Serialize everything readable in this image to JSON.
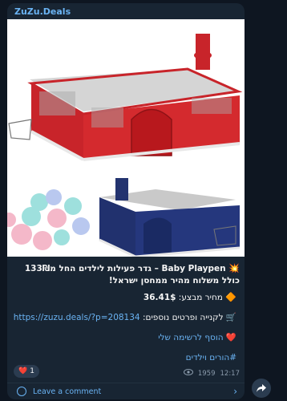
{
  "channel": {
    "name": "ZuZu.Deals"
  },
  "message": {
    "title_emoji": "💥",
    "title": "Baby Playpen – גדר פעילות לילדים החל מ133₪ כולל משלוח מהיר ממחסן ישראל!",
    "price_emoji": "🔶",
    "price_label": "מחיר מבצע:",
    "price_value": "36.41$",
    "buy_emoji": "🛒",
    "buy_label": "לקנייה ופרטים נוספים:",
    "buy_link": "https://zuzu.deals/?p=208134",
    "wishlist_emoji": "❤️",
    "wishlist_text": "הוסף לרשימה שלי",
    "hashtag": "#הורים וילדים"
  },
  "reactions": {
    "emoji": "❤️",
    "count": "1"
  },
  "meta": {
    "views": "1959",
    "time": "12:17"
  },
  "comment": {
    "label": "Leave a comment"
  },
  "colors": {
    "accent": "#6ab3f3",
    "bubble": "#182533",
    "background": "#0e1621"
  }
}
